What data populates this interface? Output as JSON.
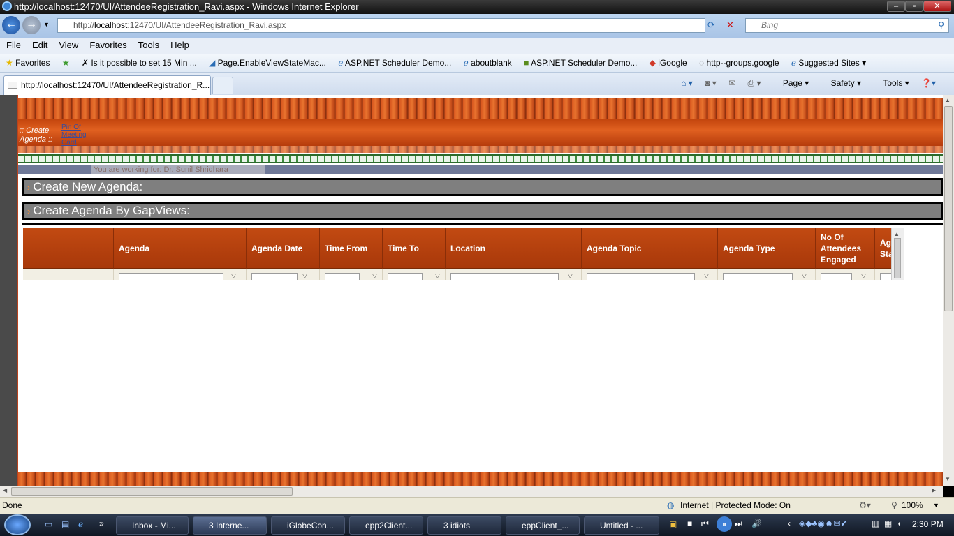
{
  "window": {
    "title": "http://localhost:12470/UI/AttendeeRegistration_Ravi.aspx - Windows Internet Explorer"
  },
  "address": {
    "prefix": "http://",
    "host": "localhost",
    "rest": ":12470/UI/AttendeeRegistration_Ravi.aspx"
  },
  "search": {
    "placeholder": "Bing"
  },
  "menu": [
    "File",
    "Edit",
    "View",
    "Favorites",
    "Tools",
    "Help"
  ],
  "favorites": {
    "label": "Favorites",
    "items": [
      "Is it possible to set 15 Min ...",
      "Page.EnableViewStateMac...",
      "ASP.NET Scheduler Demo...",
      "aboutblank",
      "ASP.NET Scheduler Demo...",
      "iGoogle",
      "http--groups.google",
      "Suggested Sites"
    ]
  },
  "tab": {
    "title": "http://localhost:12470/UI/AttendeeRegistration_R..."
  },
  "commandbar": {
    "page": "Page",
    "safety": "Safety",
    "tools": "Tools"
  },
  "page": {
    "header_label": ":: Create Agenda ::",
    "tiny_links": "Pin Of Meeting Card",
    "working_for": "You are working for: Dr. Sunil Shridhara",
    "section1": "Create New Agenda:",
    "section2": "Create Agenda By GapViews:",
    "grid_columns": [
      "",
      "",
      "",
      "",
      "Agenda",
      "Agenda Date",
      "Time From",
      "Time To",
      "Location",
      "Agenda Topic",
      "Agenda Type",
      "No Of Attendees Engaged",
      "Ag Sta"
    ]
  },
  "status": {
    "left": "Done",
    "zone": "Internet | Protected Mode: On",
    "zoom": "100%"
  },
  "taskbar": {
    "items": [
      "Inbox - Mi...",
      "3 Interne...",
      "iGlobeCon...",
      "epp2Client...",
      "3 idiots",
      "eppClient_...",
      "Untitled - ..."
    ],
    "clock": "2:30 PM"
  },
  "colors": {
    "brand_orange": "#c24a12",
    "section_gray": "#7f7f7f"
  }
}
